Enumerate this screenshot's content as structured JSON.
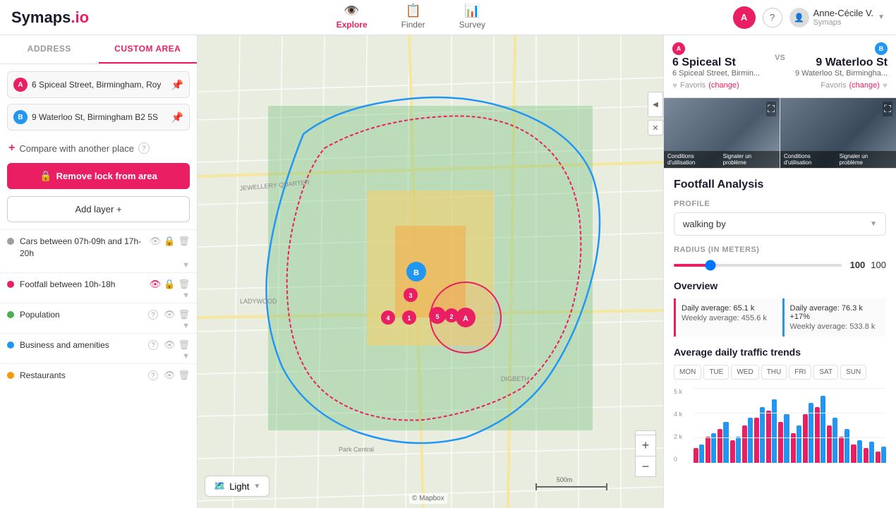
{
  "header": {
    "logo": "Symaps",
    "logo_suffix": ".io",
    "nav": [
      {
        "id": "explore",
        "label": "Explore",
        "icon": "👁️",
        "active": true
      },
      {
        "id": "finder",
        "label": "Finder",
        "icon": "📋",
        "active": false
      },
      {
        "id": "survey",
        "label": "Survey",
        "icon": "📊",
        "active": false
      }
    ],
    "user_name": "Anne-Cécile V.",
    "user_sub": "Symaps",
    "help_icon": "?",
    "avatar_text": "A"
  },
  "sidebar": {
    "tabs": [
      {
        "id": "address",
        "label": "ADDRESS",
        "active": false
      },
      {
        "id": "custom-area",
        "label": "CUSTOM AREA",
        "active": true
      }
    ],
    "addresses": [
      {
        "id": "a",
        "badge": "A",
        "text": "6 Spiceal Street, Birmingham, Roy",
        "pinned": true
      },
      {
        "id": "b",
        "badge": "B",
        "text": "9 Waterloo St, Birmingham B2 5S",
        "pinned": true
      }
    ],
    "compare_label": "Compare with another place",
    "compare_help": "?",
    "remove_lock_label": "Remove lock from area",
    "add_layer_label": "Add layer +",
    "layers": [
      {
        "id": "cars",
        "color": "#9e9e9e",
        "label": "Cars between 07h-09h and 17h-20h",
        "visible": false,
        "locked": false
      },
      {
        "id": "footfall",
        "color": "#e91e63",
        "label": "Footfall between 10h-18h",
        "visible": true,
        "locked": false
      },
      {
        "id": "population",
        "color": "#4caf50",
        "label": "Population",
        "visible": false,
        "locked": false
      },
      {
        "id": "business",
        "color": "#2196f3",
        "label": "Business and amenities",
        "visible": false,
        "locked": false
      },
      {
        "id": "restaurants",
        "color": "#ff9800",
        "label": "Restaurants",
        "visible": false,
        "locked": false
      }
    ]
  },
  "map": {
    "style_label": "Light",
    "zoom_in": "+",
    "zoom_out": "−",
    "attribution": "© Mapbox"
  },
  "right_panel": {
    "location_a": {
      "badge": "A",
      "name": "6 Spiceal St",
      "address": "6 Spiceal Street, Birmin...",
      "favoris_label": "Favoris",
      "change_label": "(change)"
    },
    "vs_label": "VS",
    "location_b": {
      "badge": "B",
      "name": "9 Waterloo St",
      "address": "9 Waterloo St, Birmingha...",
      "favoris_label": "Favoris",
      "change_label": "(change)"
    },
    "image_a_caption1": "Conditions d'utilisation",
    "image_a_caption2": "Signaler un problème",
    "image_b_caption1": "Conditions d'utilisation",
    "image_b_caption2": "Signaler un problème",
    "analysis": {
      "title": "Footfall Analysis",
      "profile_label": "PROFILE",
      "profile_value": "walking by",
      "radius_label": "RADIUS (IN METERS)",
      "radius_value": "100",
      "radius_max": "100",
      "overview_title": "Overview",
      "stat_a": {
        "daily": "Daily average: 65.1 k",
        "weekly": "Weekly average: 455.6 k"
      },
      "stat_b": {
        "daily": "Daily average: 76.3 k +17%",
        "weekly": "Weekly average: 533.8 k"
      },
      "trends_title": "Average daily traffic trends",
      "days": [
        {
          "id": "mon",
          "label": "MON",
          "active": false
        },
        {
          "id": "tue",
          "label": "TUE",
          "active": false
        },
        {
          "id": "wed",
          "label": "WED",
          "active": false
        },
        {
          "id": "thu",
          "label": "THU",
          "active": false
        },
        {
          "id": "fri",
          "label": "FRI",
          "active": false
        },
        {
          "id": "sat",
          "label": "SAT",
          "active": false
        },
        {
          "id": "sun",
          "label": "SUN",
          "active": false
        }
      ],
      "chart": {
        "y_labels": [
          "5k",
          "4k",
          "2k",
          "0"
        ],
        "bar_groups": [
          {
            "a": 20,
            "b": 25
          },
          {
            "a": 35,
            "b": 40
          },
          {
            "a": 45,
            "b": 55
          },
          {
            "a": 30,
            "b": 35
          },
          {
            "a": 50,
            "b": 60
          },
          {
            "a": 60,
            "b": 75
          },
          {
            "a": 70,
            "b": 85
          },
          {
            "a": 55,
            "b": 65
          },
          {
            "a": 40,
            "b": 50
          },
          {
            "a": 65,
            "b": 80
          },
          {
            "a": 75,
            "b": 90
          },
          {
            "a": 50,
            "b": 60
          },
          {
            "a": 35,
            "b": 45
          },
          {
            "a": 25,
            "b": 30
          },
          {
            "a": 20,
            "b": 28
          },
          {
            "a": 15,
            "b": 22
          }
        ]
      }
    }
  }
}
